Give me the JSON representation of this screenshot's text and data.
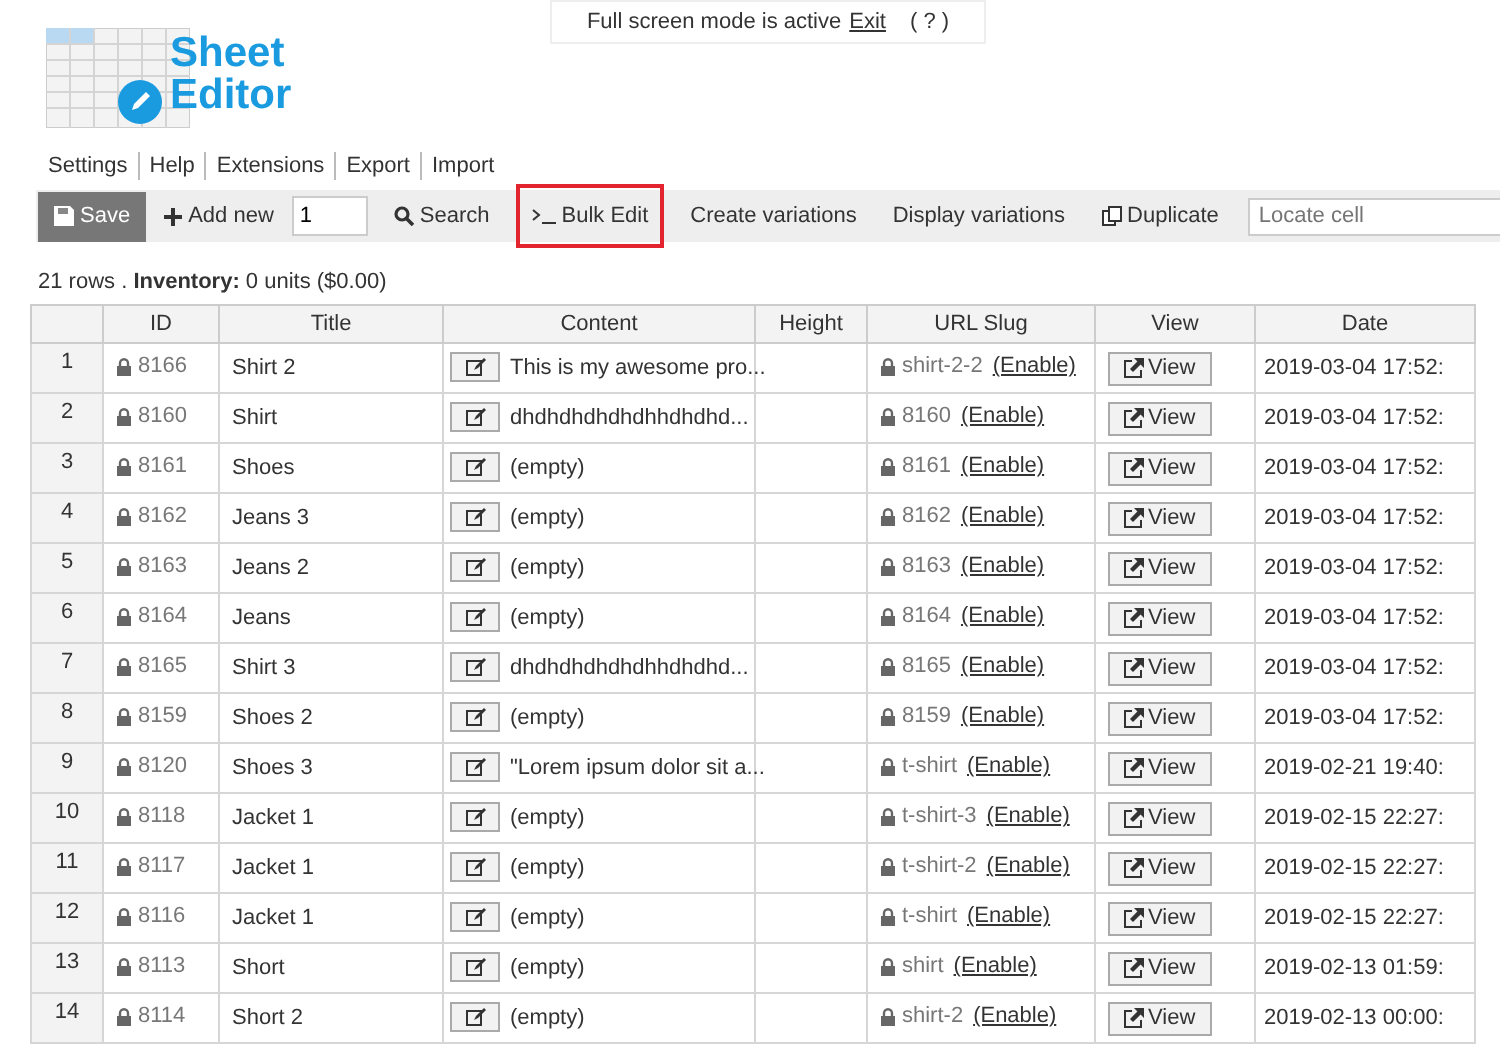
{
  "banner": {
    "text": "Full screen mode is active",
    "link": "Exit",
    "help": "( ? )"
  },
  "logo": {
    "line_1": "Sheet",
    "line_2": "Editor"
  },
  "menu": [
    "Settings",
    "Help",
    "Extensions",
    "Export",
    "Import"
  ],
  "toolbar": [
    {
      "kind": "primary",
      "label": "Save",
      "highlighted": false
    },
    {
      "kind": "add",
      "label": "Add new",
      "highlighted": false
    },
    {
      "kind": "number",
      "value": "1"
    },
    {
      "kind": "search",
      "label": "Search",
      "highlighted": false
    },
    {
      "kind": "terminal",
      "label": "Bulk Edit",
      "highlighted": true
    },
    {
      "kind": "plain",
      "label": "Create variations",
      "highlighted": false
    },
    {
      "kind": "plain",
      "label": "Display variations",
      "highlighted": false
    },
    {
      "kind": "copy",
      "label": "Duplicate",
      "highlighted": false
    },
    {
      "kind": "field",
      "placeholder": "Locate cell"
    }
  ],
  "summary": {
    "rows": "21 rows .",
    "label": "Inventory:",
    "value": "0 units ($0.00)"
  },
  "table": {
    "columns": [
      "ID",
      "Title",
      "Content",
      "Height",
      "URL Slug",
      "View",
      "Date"
    ],
    "rows": [
      {
        "n": "1",
        "id": "8166",
        "title": "Shirt 2",
        "content": "This is my awesome pro...",
        "slug": "shirt-2-2",
        "enable": "(Enable)",
        "view": "View",
        "date": "2019-03-04 17:52:"
      },
      {
        "n": "2",
        "id": "8160",
        "title": "Shirt",
        "content": "dhdhdhdhdhdhhdhdhd...",
        "slug": "8160",
        "enable": "(Enable)",
        "view": "View",
        "date": "2019-03-04 17:52:"
      },
      {
        "n": "3",
        "id": "8161",
        "title": "Shoes",
        "content": "(empty)",
        "slug": "8161",
        "enable": "(Enable)",
        "view": "View",
        "date": "2019-03-04 17:52:"
      },
      {
        "n": "4",
        "id": "8162",
        "title": "Jeans 3",
        "content": "(empty)",
        "slug": "8162",
        "enable": "(Enable)",
        "view": "View",
        "date": "2019-03-04 17:52:"
      },
      {
        "n": "5",
        "id": "8163",
        "title": "Jeans 2",
        "content": "(empty)",
        "slug": "8163",
        "enable": "(Enable)",
        "view": "View",
        "date": "2019-03-04 17:52:"
      },
      {
        "n": "6",
        "id": "8164",
        "title": "Jeans",
        "content": "(empty)",
        "slug": "8164",
        "enable": "(Enable)",
        "view": "View",
        "date": "2019-03-04 17:52:"
      },
      {
        "n": "7",
        "id": "8165",
        "title": "Shirt 3",
        "content": "dhdhdhdhdhdhhdhdhd...",
        "slug": "8165",
        "enable": "(Enable)",
        "view": "View",
        "date": "2019-03-04 17:52:"
      },
      {
        "n": "8",
        "id": "8159",
        "title": "Shoes 2",
        "content": "(empty)",
        "slug": "8159",
        "enable": "(Enable)",
        "view": "View",
        "date": "2019-03-04 17:52:"
      },
      {
        "n": "9",
        "id": "8120",
        "title": "Shoes 3",
        "content": "\"Lorem ipsum dolor sit a...",
        "slug": "t-shirt",
        "enable": "(Enable)",
        "view": "View",
        "date": "2019-02-21 19:40:"
      },
      {
        "n": "10",
        "id": "8118",
        "title": "Jacket 1",
        "content": "(empty)",
        "slug": "t-shirt-3",
        "enable": "(Enable)",
        "view": "View",
        "date": "2019-02-15 22:27:"
      },
      {
        "n": "11",
        "id": "8117",
        "title": "Jacket 1",
        "content": "(empty)",
        "slug": "t-shirt-2",
        "enable": "(Enable)",
        "view": "View",
        "date": "2019-02-15 22:27:"
      },
      {
        "n": "12",
        "id": "8116",
        "title": "Jacket 1",
        "content": "(empty)",
        "slug": "t-shirt",
        "enable": "(Enable)",
        "view": "View",
        "date": "2019-02-15 22:27:"
      },
      {
        "n": "13",
        "id": "8113",
        "title": "Short",
        "content": "(empty)",
        "slug": "shirt",
        "enable": "(Enable)",
        "view": "View",
        "date": "2019-02-13 01:59:"
      },
      {
        "n": "14",
        "id": "8114",
        "title": "Short 2",
        "content": "(empty)",
        "slug": "shirt-2",
        "enable": "(Enable)",
        "view": "View",
        "date": "2019-02-13 00:00:"
      }
    ]
  }
}
